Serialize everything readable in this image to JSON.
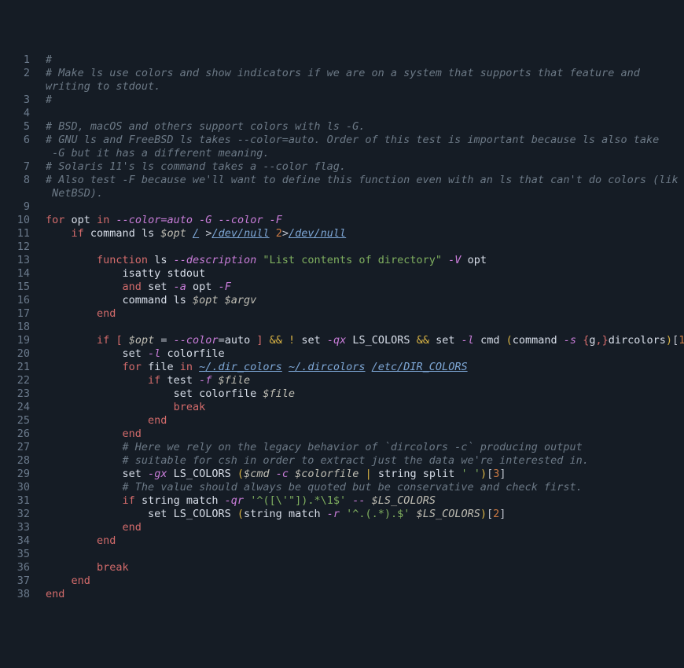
{
  "line_count": 38,
  "comments": {
    "l1": "#",
    "l2": "# Make ls use colors and show indicators if we are on a system that supports that feature and writing to stdout.",
    "l3": "#",
    "l5": "# BSD, macOS and others support colors with ls -G.",
    "l6": "# GNU ls and FreeBSD ls takes --color=auto. Order of this test is important because ls also takes -G but it has a different meaning.",
    "l7": "# Solaris 11's ls command takes a --color flag.",
    "l8": "# Also test -F because we'll want to define this function even with an ls that can't do colors (like NetBSD).",
    "l27": "# Here we rely on the legacy behavior of `dircolors -c` producing output",
    "l28": "# suitable for csh in order to extract just the data we're interested in.",
    "l30": "# The value should always be quoted but be conservative and check first."
  },
  "kw": {
    "for": "for",
    "in": "in",
    "if": "if",
    "function": "function",
    "and": "and",
    "break": "break",
    "end": "end"
  },
  "cmd": {
    "command": "command",
    "ls": "ls",
    "isatty": "isatty",
    "set": "set",
    "test": "test",
    "string": "string",
    "match": "match",
    "split": "split",
    "dircolors": "dircolors"
  },
  "ids": {
    "opt_var": "opt",
    "stdout": "stdout",
    "LS_COLORS": "LS_COLORS",
    "cmd": "cmd",
    "g": "g",
    "colorfile": "colorfile",
    "file": "file"
  },
  "opts": {
    "color_auto": "--color=auto",
    "G": "-G",
    "color": "--color",
    "F": "-F",
    "description": "description",
    "V": "V",
    "a": "a",
    "qx": "qx",
    "l": "l",
    "s": "s",
    "f": "f",
    "gx": "gx",
    "c": "c",
    "qr": "qr",
    "r": "r",
    "dashdash": "--"
  },
  "strings": {
    "desc": "\"List contents of directory\"",
    "eq_auto": "auto",
    "sq_space": "' '",
    "re1": "'^([\\'\"]).*\\1$'",
    "re2": "'^.(.*).$'"
  },
  "vars": {
    "opt": "$opt",
    "argv": "$argv",
    "cmd": "$cmd",
    "colorfile": "$colorfile",
    "file": "$file",
    "LS_COLORS": "$LS_COLORS"
  },
  "paths": {
    "slash": "/",
    "devnull": "/dev/null",
    "tilde": "~",
    "dir_colors": "/.dir_colors",
    "dircolors": "/.dircolors",
    "etc": "/etc/DIR_COLORS"
  },
  "ops": {
    "gt": ">",
    "two": "2",
    "lbr": "[",
    "rbr": "]",
    "eq": "=",
    "ampamp": "&&",
    "bang": "!",
    "pipe": "|",
    "lpar": "(",
    "rpar": ")",
    "lcur": "{",
    "rcur": "}",
    "comma": ",",
    "dash": "-",
    "ddash": "--"
  },
  "nums": {
    "one": "1",
    "two": "2",
    "three": "3"
  }
}
